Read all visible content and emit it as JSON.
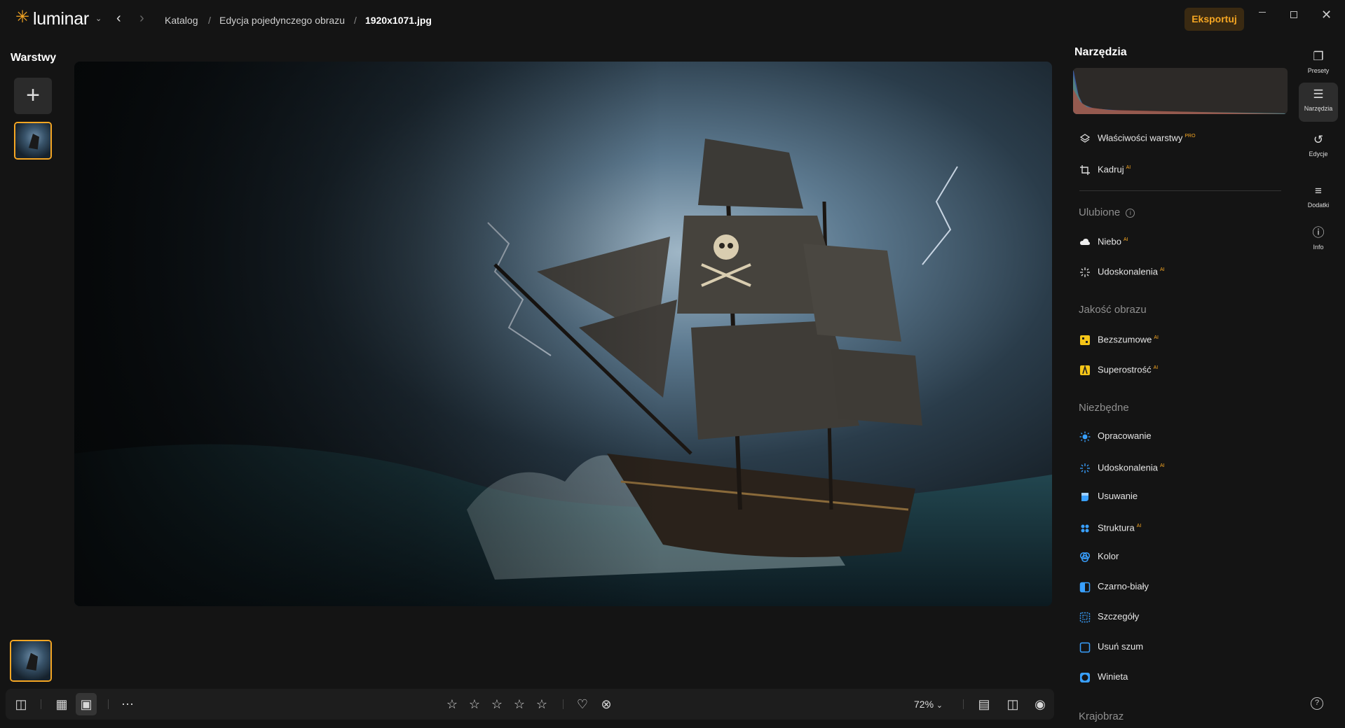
{
  "app": {
    "logo_text": "luminar"
  },
  "breadcrumb": {
    "items": [
      "Katalog",
      "Edycja pojedynczego obrazu",
      "1920x1071.jpg"
    ]
  },
  "header": {
    "export_label": "Eksportuj"
  },
  "layers": {
    "title": "Warstwy"
  },
  "tools": {
    "title": "Narzędzia",
    "top_items": [
      {
        "label": "Właściwości warstwy",
        "badge": "PRO",
        "icon": "layers-icon"
      },
      {
        "label": "Kadruj",
        "badge": "AI",
        "icon": "crop-icon"
      }
    ],
    "sections": [
      {
        "title": "Ulubione",
        "items": [
          {
            "label": "Niebo",
            "badge": "AI",
            "icon": "cloud-icon"
          },
          {
            "label": "Udoskonalenia",
            "badge": "AI",
            "icon": "sparkle-icon"
          }
        ]
      },
      {
        "title": "Jakość obrazu",
        "items": [
          {
            "label": "Bezszumowe",
            "badge": "AI",
            "icon": "noiseless-icon"
          },
          {
            "label": "Superostrość",
            "badge": "AI",
            "icon": "supersharp-icon"
          }
        ]
      },
      {
        "title": "Niezbędne",
        "items": [
          {
            "label": "Opracowanie",
            "icon": "sun-icon"
          },
          {
            "label": "Udoskonalenia",
            "badge": "AI",
            "icon": "sparkle-blue-icon"
          },
          {
            "label": "Usuwanie",
            "icon": "eraser-icon"
          },
          {
            "label": "Struktura",
            "badge": "AI",
            "icon": "structure-icon"
          },
          {
            "label": "Kolor",
            "icon": "color-icon"
          },
          {
            "label": "Czarno-biały",
            "icon": "bw-icon"
          },
          {
            "label": "Szczegóły",
            "icon": "details-icon"
          },
          {
            "label": "Usuń szum",
            "icon": "denoise-icon"
          },
          {
            "label": "Winieta",
            "icon": "vignette-icon"
          }
        ]
      },
      {
        "title": "Krajobraz",
        "items": []
      }
    ]
  },
  "side_strip": [
    {
      "label": "Presety",
      "icon": "presets-icon"
    },
    {
      "label": "Narzędzia",
      "icon": "sliders-icon",
      "active": true
    },
    {
      "label": "Edycje",
      "icon": "history-icon"
    },
    {
      "label": "Dodatki",
      "icon": "list-icon"
    },
    {
      "label": "Info",
      "icon": "info-icon"
    }
  ],
  "bottom": {
    "zoom": "72%",
    "rating": 0,
    "rating_max": 5
  },
  "colors": {
    "accent": "#f5a623",
    "background": "#141414",
    "panel": "#1d1d1d"
  }
}
